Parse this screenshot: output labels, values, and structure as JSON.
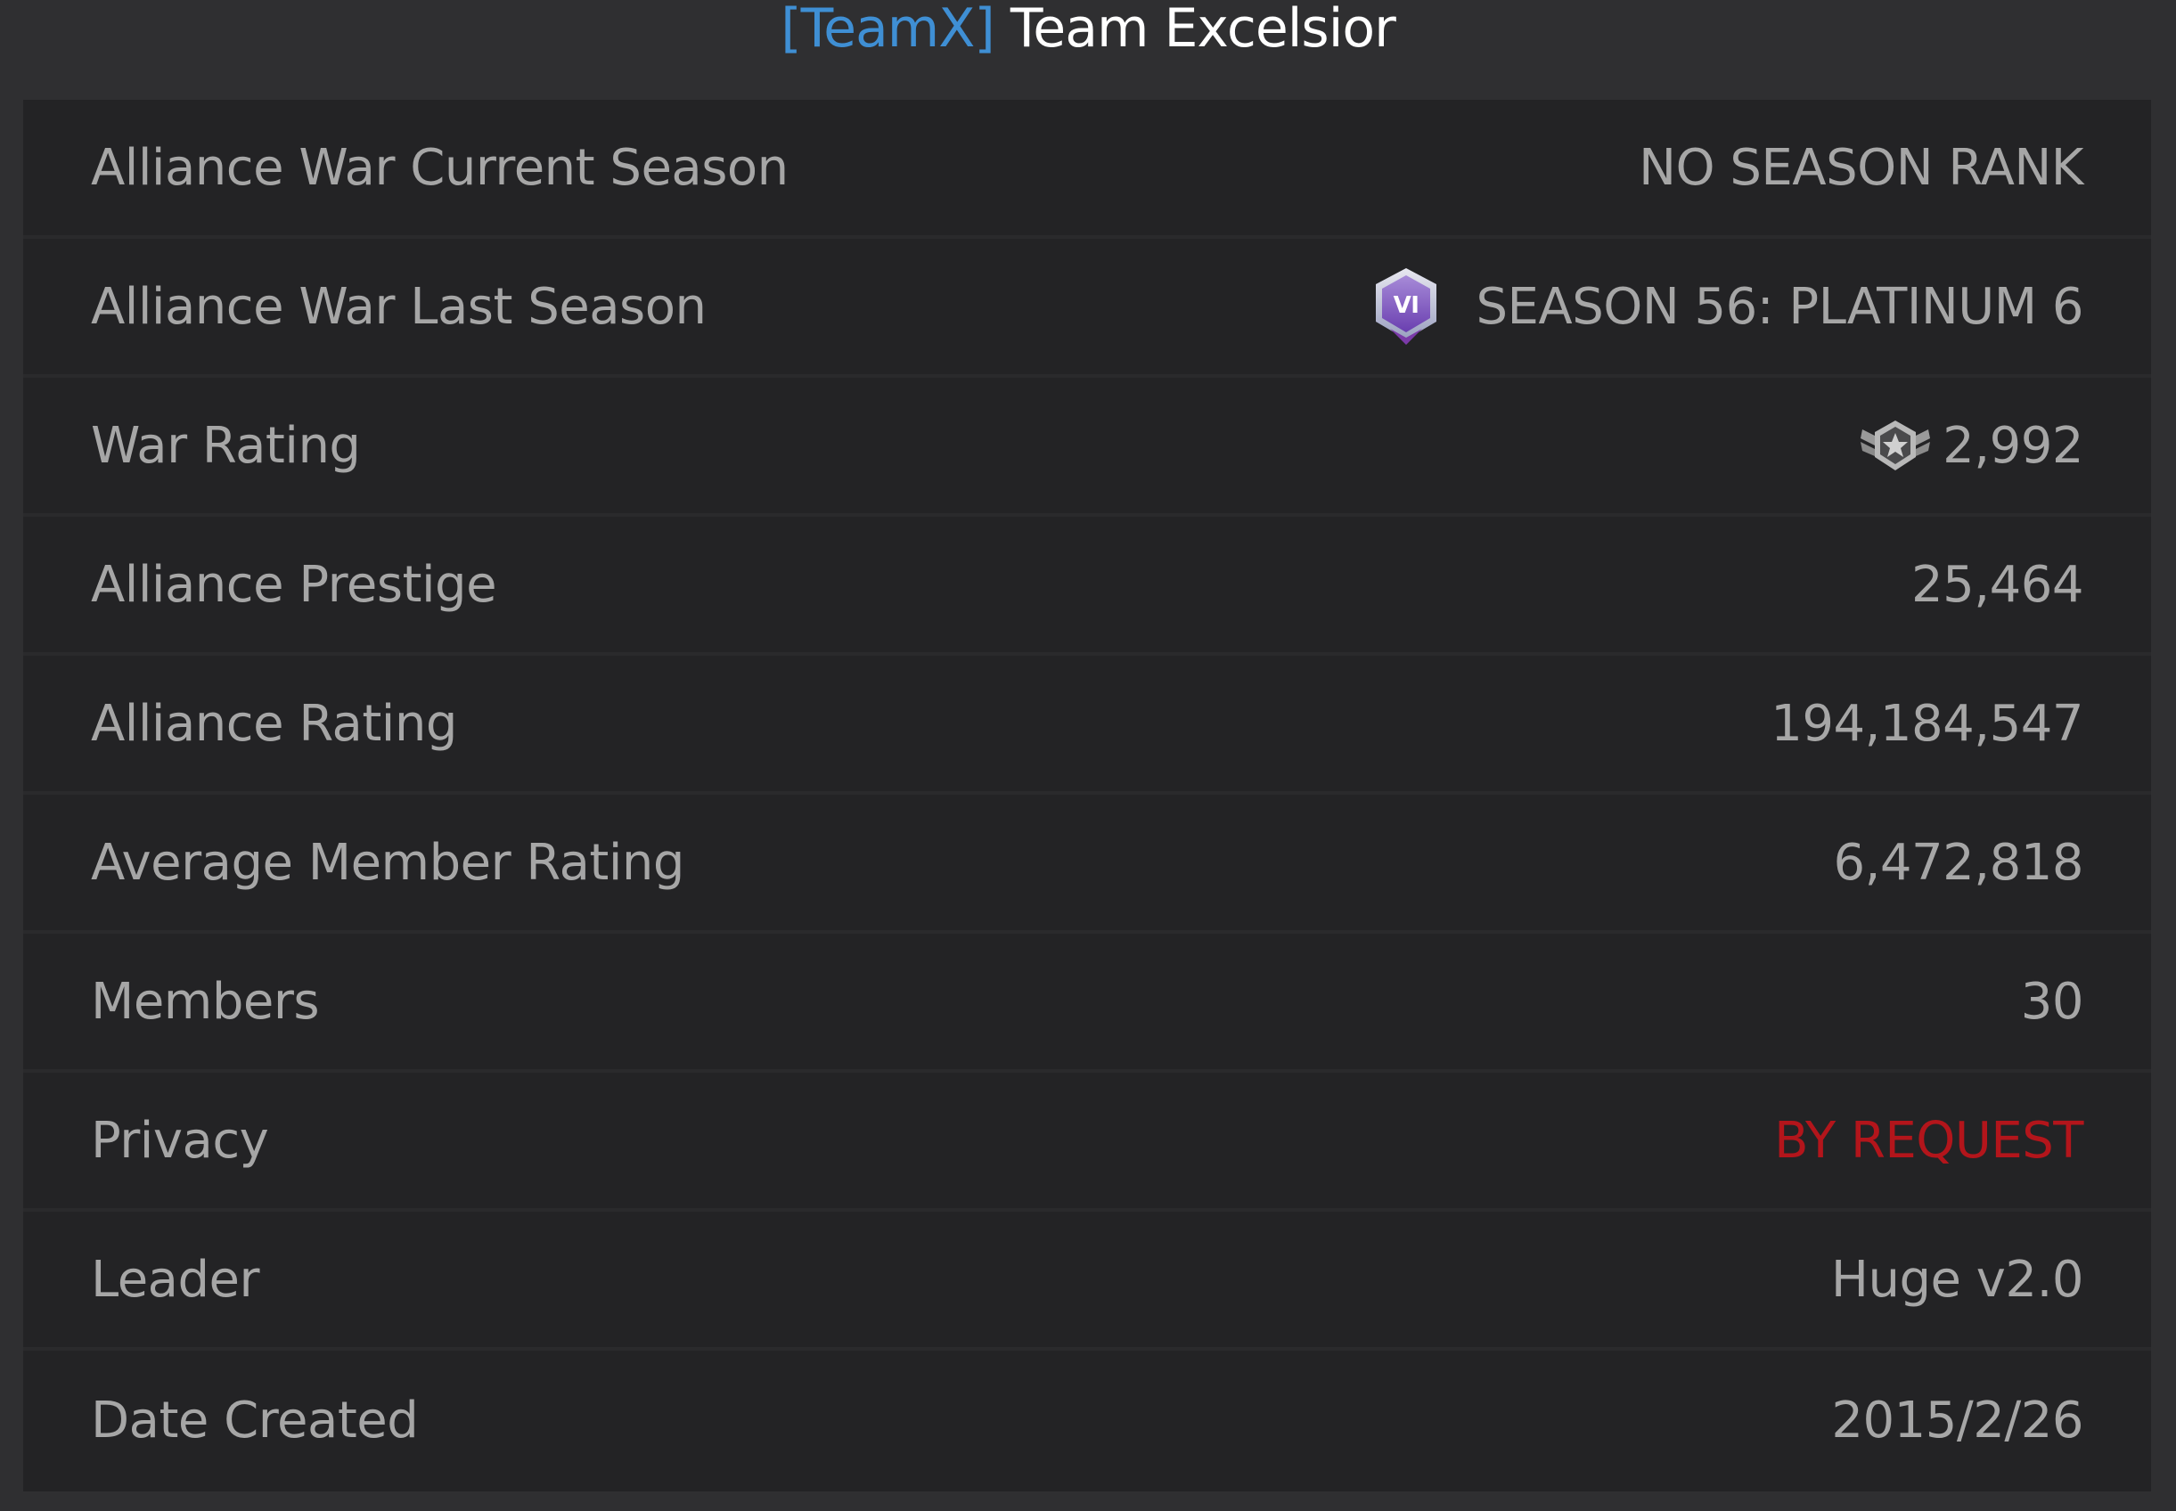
{
  "header": {
    "tag": "[TeamX]",
    "name": " Team Excelsior"
  },
  "rows": [
    {
      "label": "Alliance War Current Season",
      "value": "NO SEASON RANK"
    },
    {
      "label": "Alliance War Last Season",
      "value": "SEASON 56: PLATINUM 6",
      "icon": "platinum-vi-badge-icon",
      "badge_text": "VI"
    },
    {
      "label": "War Rating",
      "value": "2,992",
      "icon": "winged-star-icon"
    },
    {
      "label": "Alliance Prestige",
      "value": "25,464"
    },
    {
      "label": "Alliance Rating",
      "value": "194,184,547"
    },
    {
      "label": "Average Member Rating",
      "value": "6,472,818"
    },
    {
      "label": "Members",
      "value": "30"
    },
    {
      "label": "Privacy",
      "value": "BY REQUEST",
      "color": "#b3151b"
    },
    {
      "label": "Leader",
      "value": "Huge v2.0"
    },
    {
      "label": "Date Created",
      "value": "2015/2/26"
    }
  ],
  "colors": {
    "tag": "#3f8fd4",
    "title": "#ffffff",
    "text": "#a6a6a6",
    "panel": "#232325",
    "background": "#2f2f31"
  }
}
